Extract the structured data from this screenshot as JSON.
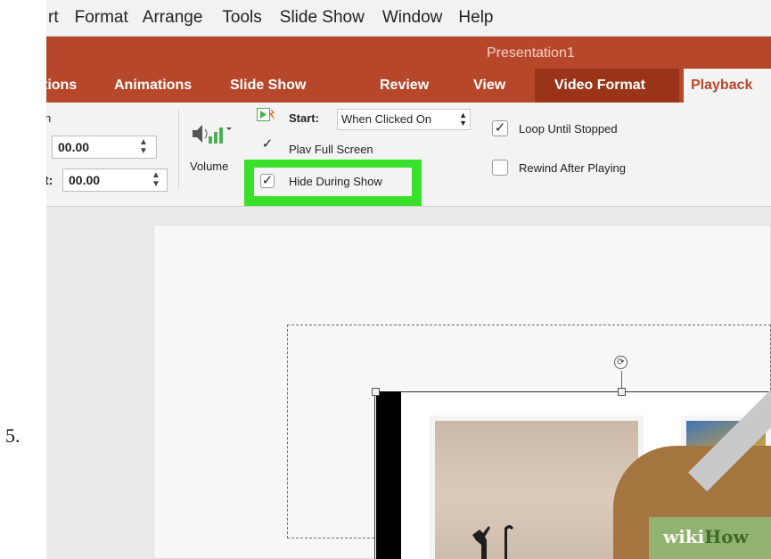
{
  "step": "5.",
  "menu": [
    "rt",
    "Format",
    "Arrange",
    "Tools",
    "Slide Show",
    "Window",
    "Help"
  ],
  "document_title": "Presentation1",
  "tabs": [
    "tions",
    "Animations",
    "Slide Show",
    "Review",
    "View",
    "Video Format",
    "Playback"
  ],
  "ribbon": {
    "fade_label_partial": "n",
    "fade_in_value": "00.00",
    "fade_out_label_partial": "t:",
    "fade_out_value": "00.00",
    "volume_label": "Volume",
    "start_label": "Start:",
    "start_value": "When Clicked On",
    "play_full_screen": "Play Full Screen",
    "hide_during_show": "Hide During Show",
    "loop_until_stopped": "Loop Until Stopped",
    "rewind_after_playing": "Rewind After Playing"
  },
  "watermark": {
    "wiki": "wiki",
    "how": "How"
  },
  "colors": {
    "accent": "#b7472a",
    "highlight": "#3ae12a"
  }
}
